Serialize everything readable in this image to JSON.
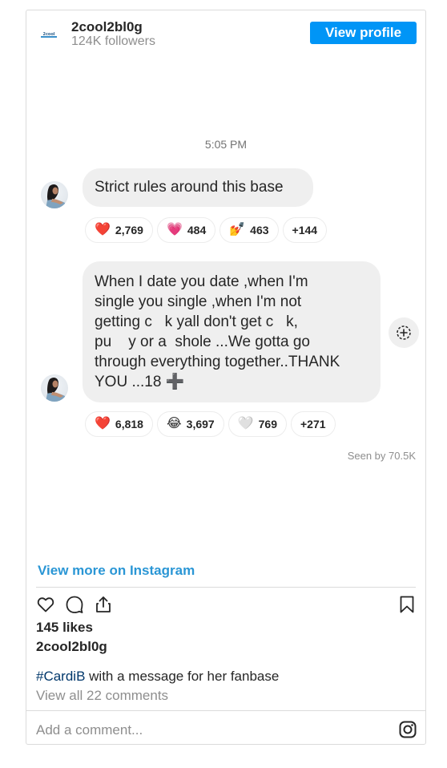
{
  "header": {
    "username": "2cool2bl0g",
    "followers": "124K followers",
    "view_profile_label": "View profile",
    "avatar_icon": "brand-logo-icon"
  },
  "chat": {
    "timestamp": "5:05 PM",
    "message1": {
      "text": "Strict rules around this base",
      "reactions": [
        {
          "emoji": "❤️",
          "count": "2,769",
          "icon": "red-heart-icon"
        },
        {
          "emoji": "💗",
          "count": "484",
          "icon": "pink-heart-icon"
        },
        {
          "emoji": "💅",
          "count": "463",
          "icon": "nail-polish-icon"
        },
        {
          "emoji": "",
          "count": "+144",
          "icon": ""
        }
      ]
    },
    "message2": {
      "lines": [
        "When I date you date ,when I'm",
        "single you single ,when I'm not",
        "getting c   k yall don't get c   k,",
        "pu    y or a  shole ...We gotta go",
        "through everything together..THANK",
        "YOU ...18 ➕"
      ],
      "reactions": [
        {
          "emoji": "❤️",
          "count": "6,818",
          "icon": "red-heart-icon"
        },
        {
          "emoji": "😂",
          "count": "3,697",
          "icon": "laughing-face-icon"
        },
        {
          "emoji": "🤍",
          "count": "769",
          "icon": "white-heart-icon"
        },
        {
          "emoji": "",
          "count": "+271",
          "icon": ""
        }
      ]
    },
    "seen_by": "Seen by 70.5K"
  },
  "post": {
    "view_more": "View more on Instagram",
    "likes": "145 likes",
    "poster": "2cool2bl0g",
    "caption_hashtag": "#CardiB",
    "caption_text": " with a message for her fanbase",
    "view_comments": "View all 22 comments",
    "comment_placeholder": "Add a comment..."
  },
  "colors": {
    "accent": "#0095f6",
    "link": "#2a96d5",
    "hashtag": "#00376b",
    "bubble": "#efefef"
  }
}
